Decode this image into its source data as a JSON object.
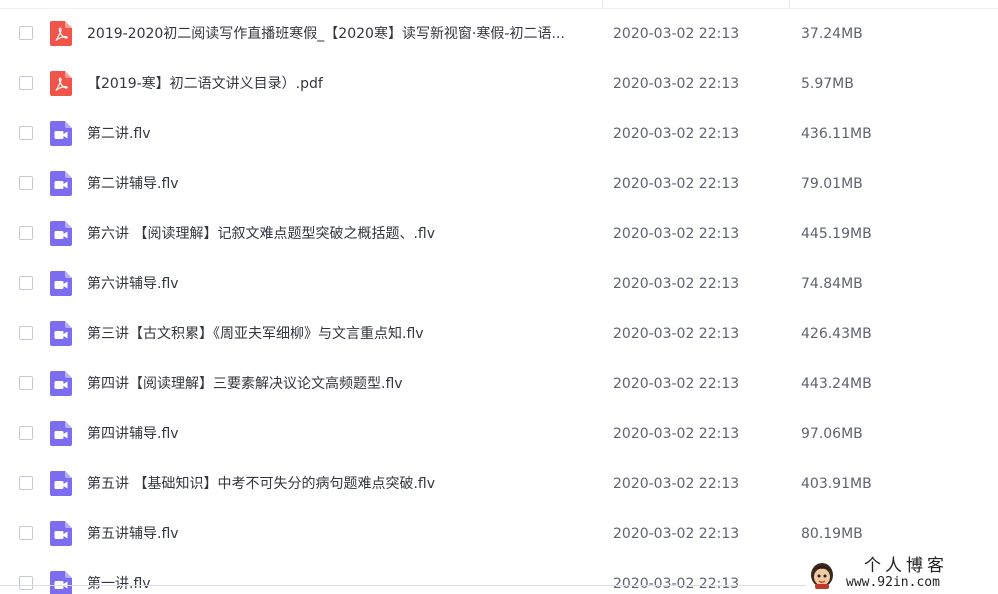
{
  "files": [
    {
      "type": "pdf",
      "icon": "pdf-file-icon",
      "name": "2019-2020初二阅读写作直播班寒假_【2020寒】读写新视窗·寒假-初二语...",
      "date": "2020-03-02 22:13",
      "size": "37.24MB"
    },
    {
      "type": "pdf",
      "icon": "pdf-file-icon",
      "name": "【2019-寒】初二语文讲义目录）.pdf",
      "date": "2020-03-02 22:13",
      "size": "5.97MB"
    },
    {
      "type": "video",
      "icon": "video-file-icon",
      "name": "第二讲.flv",
      "date": "2020-03-02 22:13",
      "size": "436.11MB"
    },
    {
      "type": "video",
      "icon": "video-file-icon",
      "name": "第二讲辅导.flv",
      "date": "2020-03-02 22:13",
      "size": "79.01MB"
    },
    {
      "type": "video",
      "icon": "video-file-icon",
      "name": "第六讲 【阅读理解】记叙文难点题型突破之概括题、.flv",
      "date": "2020-03-02 22:13",
      "size": "445.19MB"
    },
    {
      "type": "video",
      "icon": "video-file-icon",
      "name": "第六讲辅导.flv",
      "date": "2020-03-02 22:13",
      "size": "74.84MB"
    },
    {
      "type": "video",
      "icon": "video-file-icon",
      "name": "第三讲【古文积累】《周亚夫军细柳》与文言重点知.flv",
      "date": "2020-03-02 22:13",
      "size": "426.43MB"
    },
    {
      "type": "video",
      "icon": "video-file-icon",
      "name": "第四讲【阅读理解】三要素解决议论文高频题型.flv",
      "date": "2020-03-02 22:13",
      "size": "443.24MB"
    },
    {
      "type": "video",
      "icon": "video-file-icon",
      "name": "第四讲辅导.flv",
      "date": "2020-03-02 22:13",
      "size": "97.06MB"
    },
    {
      "type": "video",
      "icon": "video-file-icon",
      "name": "第五讲 【基础知识】中考不可失分的病句题难点突破.flv",
      "date": "2020-03-02 22:13",
      "size": "403.91MB"
    },
    {
      "type": "video",
      "icon": "video-file-icon",
      "name": "第五讲辅导.flv",
      "date": "2020-03-02 22:13",
      "size": "80.19MB"
    },
    {
      "type": "video",
      "icon": "video-file-icon",
      "name": "第一讲.flv",
      "date": "2020-03-02 22:13",
      "size": ""
    }
  ],
  "watermark": {
    "title": "个人博客",
    "url": "www.92in.com"
  },
  "colors": {
    "pdf_icon": "#f0554a",
    "video_icon": "#7b6cf0",
    "text_primary": "#333640",
    "text_secondary": "#5e6370"
  }
}
